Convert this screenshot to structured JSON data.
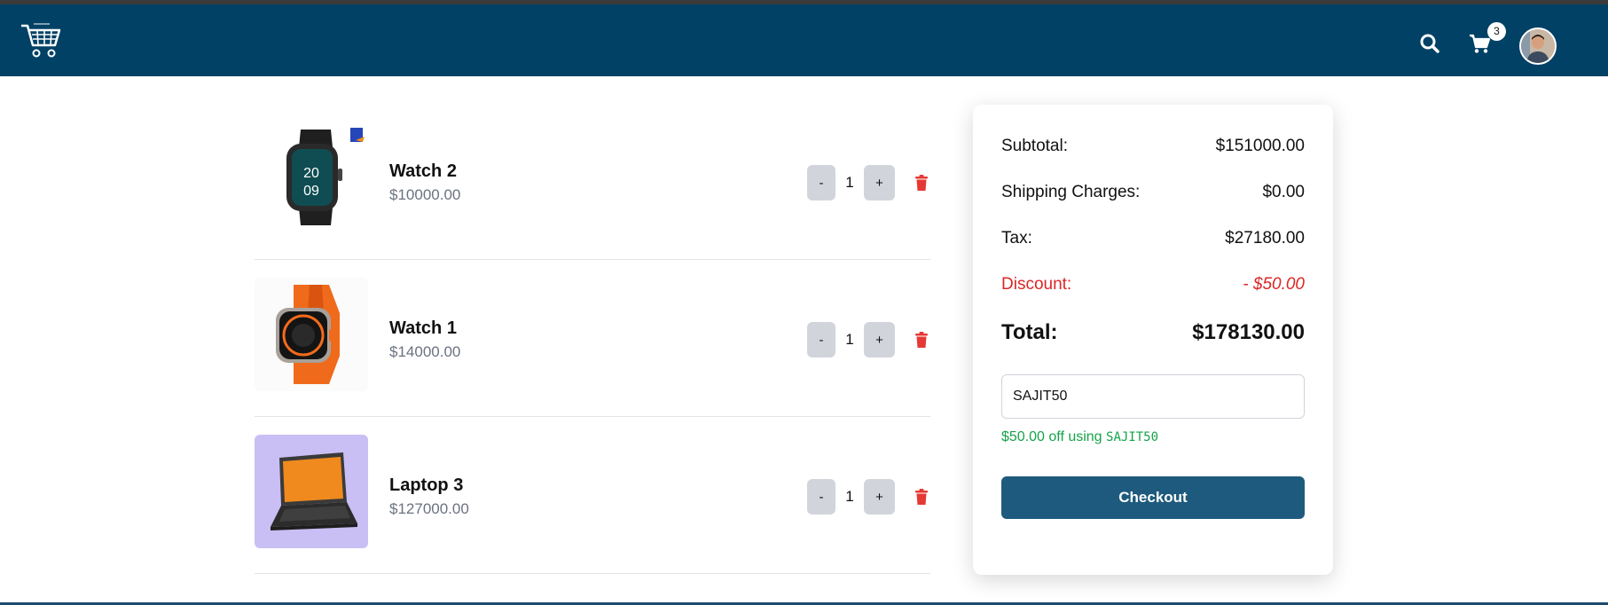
{
  "navbar": {
    "logo_icon": "shopping-cart-logo-icon",
    "search_icon": "search-icon",
    "cart_icon": "cart-icon",
    "cart_count": "3",
    "avatar": "user-avatar",
    "background": "#004165"
  },
  "cart": {
    "items": [
      {
        "name": "Watch 2",
        "price": "$10000.00",
        "quantity": "1",
        "minus": "-",
        "plus": "+",
        "image": "smartwatch-black"
      },
      {
        "name": "Watch 1",
        "price": "$14000.00",
        "quantity": "1",
        "minus": "-",
        "plus": "+",
        "image": "smartwatch-orange"
      },
      {
        "name": "Laptop 3",
        "price": "$127000.00",
        "quantity": "1",
        "minus": "-",
        "plus": "+",
        "image": "laptop-orange-screen"
      }
    ]
  },
  "summary": {
    "subtotal_label": "Subtotal:",
    "subtotal_value": "$151000.00",
    "shipping_label": "Shipping Charges:",
    "shipping_value": "$0.00",
    "tax_label": "Tax:",
    "tax_value": "$27180.00",
    "discount_label": "Discount:",
    "discount_value": "- $50.00",
    "total_label": "Total:",
    "total_value": "$178130.00",
    "coupon_value": "SAJIT50",
    "coupon_message": "$50.00 off using",
    "coupon_code": "SAJIT50",
    "checkout_label": "Checkout"
  },
  "colors": {
    "accent": "#1e5a7d",
    "discount": "#dc2626",
    "success": "#16a34a",
    "delete": "#e53935"
  }
}
